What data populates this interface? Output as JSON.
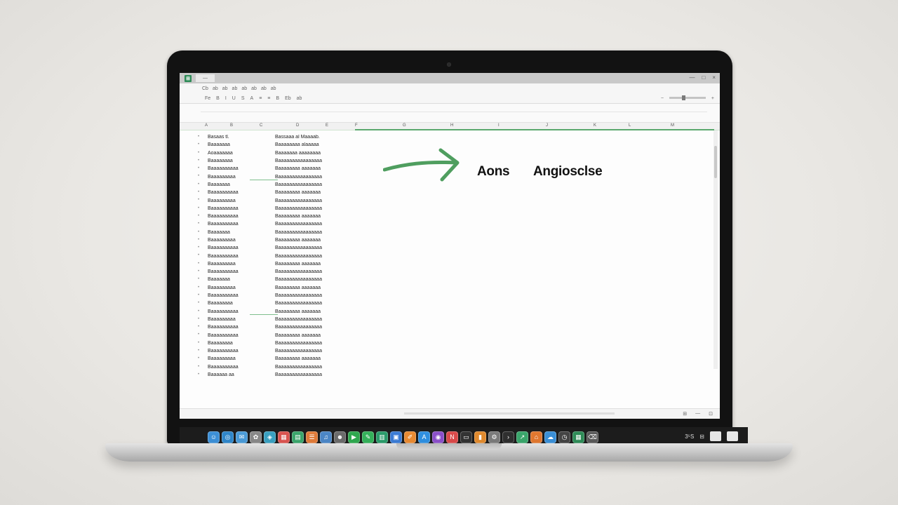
{
  "window": {
    "tab_title": "—",
    "controls": [
      "—",
      "□",
      "×"
    ]
  },
  "toolbar": {
    "row1": [
      "Cb",
      "ab",
      "ab",
      "ab",
      "ab",
      "ab",
      "ab",
      "ab"
    ],
    "row2": [
      "Fe",
      "B",
      "I",
      "U",
      "S",
      "A",
      "≡",
      "≡",
      "B",
      "Eb",
      "ab"
    ]
  },
  "columns": [
    "A",
    "B",
    "C",
    "D",
    "E",
    "F",
    "G",
    "H",
    "I",
    "J",
    "K",
    "L",
    "M"
  ],
  "sheet_rows": [
    [
      "Basaas tl.",
      "Bassaaa al Maaaab."
    ],
    [
      "Baaaaaaa",
      "Baaaaaaaa alaaaaa"
    ],
    [
      "Aoaaaaaaa",
      "Baaaaaaa aaaaaaaa"
    ],
    [
      "Baaaaaaaa",
      "Baaaaaaaaaaaaaaaa"
    ],
    [
      "Baaaaaaaaaa",
      "Baaaaaaaa aaaaaaa"
    ],
    [
      "Baaaaaaaaa",
      "Baaaaaaaaaaaaaaaa"
    ],
    [
      "Baaaaaaa",
      "Baaaaaaaaaaaaaaaa"
    ],
    [
      "Baaaaaaaaaa",
      "Baaaaaaaa aaaaaaa"
    ],
    [
      "Baaaaaaaaa",
      "Baaaaaaaaaaaaaaaa"
    ],
    [
      "Baaaaaaaaaa",
      "Baaaaaaaaaaaaaaaa"
    ],
    [
      "Baaaaaaaaaa",
      "Baaaaaaaa aaaaaaa"
    ],
    [
      "Baaaaaaaaaa",
      "Baaaaaaaaaaaaaaaa"
    ],
    [
      "Baaaaaaa",
      "Baaaaaaaaaaaaaaaa"
    ],
    [
      "Baaaaaaaaa",
      "Baaaaaaaa aaaaaaa"
    ],
    [
      "Baaaaaaaaaa",
      "Baaaaaaaaaaaaaaaa"
    ],
    [
      "Baaaaaaaaaa",
      "Baaaaaaaaaaaaaaaa"
    ],
    [
      "Baaaaaaaaa",
      "Baaaaaaaa aaaaaaa"
    ],
    [
      "Baaaaaaaaaa",
      "Baaaaaaaaaaaaaaaa"
    ],
    [
      "Baaaaaaa",
      "Baaaaaaaaaaaaaaaa"
    ],
    [
      "Baaaaaaaaa",
      "Baaaaaaaa aaaaaaa"
    ],
    [
      "Baaaaaaaaaa",
      "Baaaaaaaaaaaaaaaa"
    ],
    [
      "Baaaaaaaa",
      "Baaaaaaaaaaaaaaaa"
    ],
    [
      "Baaaaaaaaaa",
      "Baaaaaaaa aaaaaaa"
    ],
    [
      "Baaaaaaaaa",
      "Baaaaaaaaaaaaaaaa"
    ],
    [
      "Baaaaaaaaaa",
      "Baaaaaaaaaaaaaaaa"
    ],
    [
      "Baaaaaaaaaa",
      "Baaaaaaaa aaaaaaa"
    ],
    [
      "Baaaaaaaa",
      "Baaaaaaaaaaaaaaaa"
    ],
    [
      "Baaaaaaaaaa",
      "Baaaaaaaaaaaaaaaa"
    ],
    [
      "Baaaaaaaaa",
      "Baaaaaaaa aaaaaaa"
    ],
    [
      "Baaaaaaaaaa",
      "Baaaaaaaaaaaaaaaa"
    ],
    [
      "Baaaaaa aa",
      "Baaaaaaaaaaaaaaaa"
    ]
  ],
  "labels": {
    "left": "Aons",
    "right": "Angiosclse"
  },
  "status": {
    "sheet": "",
    "right": [
      "⊞",
      "—",
      "⊡"
    ]
  },
  "accent_color": "#4f9e5f",
  "dock": {
    "icons": [
      {
        "name": "finder",
        "color": "#3c8fd6",
        "glyph": "☺"
      },
      {
        "name": "safari",
        "color": "#2f86c9",
        "glyph": "◎"
      },
      {
        "name": "mail",
        "color": "#4a9ad6",
        "glyph": "✉"
      },
      {
        "name": "photos",
        "color": "#888888",
        "glyph": "✿"
      },
      {
        "name": "maps",
        "color": "#3aa0c0",
        "glyph": "◈"
      },
      {
        "name": "calendar",
        "color": "#d9534f",
        "glyph": "▦"
      },
      {
        "name": "notes",
        "color": "#3aa56b",
        "glyph": "▤"
      },
      {
        "name": "reminders",
        "color": "#e07b39",
        "glyph": "☰"
      },
      {
        "name": "music",
        "color": "#4b86c6",
        "glyph": "♫"
      },
      {
        "name": "contacts",
        "color": "#6b6b6b",
        "glyph": "☻"
      },
      {
        "name": "facetime",
        "color": "#2fa84f",
        "glyph": "▶"
      },
      {
        "name": "messages",
        "color": "#34b05a",
        "glyph": "✎"
      },
      {
        "name": "numbers",
        "color": "#2b9b6a",
        "glyph": "▥"
      },
      {
        "name": "keynote",
        "color": "#3b7bd4",
        "glyph": "▣"
      },
      {
        "name": "pages",
        "color": "#e88a32",
        "glyph": "✐"
      },
      {
        "name": "appstore",
        "color": "#2f8fe0",
        "glyph": "A"
      },
      {
        "name": "podcasts",
        "color": "#8b4fc9",
        "glyph": "◉"
      },
      {
        "name": "news",
        "color": "#d94a4a",
        "glyph": "N"
      },
      {
        "name": "tv",
        "color": "#333333",
        "glyph": "▭"
      },
      {
        "name": "books",
        "color": "#e08a2e",
        "glyph": "▮"
      },
      {
        "name": "settings",
        "color": "#7a7a7a",
        "glyph": "⚙"
      },
      {
        "name": "terminal",
        "color": "#2f2f2f",
        "glyph": "›"
      },
      {
        "name": "stocks",
        "color": "#3aa56b",
        "glyph": "↗"
      },
      {
        "name": "home",
        "color": "#e0772f",
        "glyph": "⌂"
      },
      {
        "name": "weather",
        "color": "#3b8fd6",
        "glyph": "☁"
      },
      {
        "name": "clock",
        "color": "#444444",
        "glyph": "◷"
      },
      {
        "name": "spreadsheet",
        "color": "#2e8b57",
        "glyph": "▦"
      },
      {
        "name": "trash",
        "color": "#5a5a5a",
        "glyph": "⌫"
      }
    ],
    "right": [
      "3⁵S",
      "⊟",
      ""
    ]
  }
}
